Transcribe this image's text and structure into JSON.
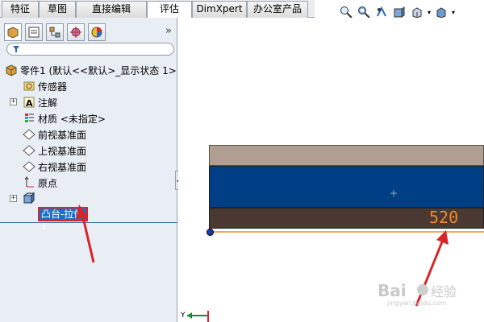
{
  "tabs": [
    {
      "label": "特征",
      "active": false
    },
    {
      "label": "草图",
      "active": false
    },
    {
      "label": "直接编辑",
      "active": false
    },
    {
      "label": "评估",
      "active": true
    },
    {
      "label": "DimXpert",
      "active": false
    },
    {
      "label": "办公室产品",
      "active": false
    }
  ],
  "toolbar": {
    "icons": [
      "zoom-to-fit-icon",
      "zoom-area-icon",
      "previous-view-icon",
      "section-view-icon",
      "view-orientation-icon",
      "display-style-icon"
    ]
  },
  "sidebar": {
    "tab_icons": [
      "feature-manager-icon",
      "property-manager-icon",
      "configuration-manager-icon",
      "dimxpert-manager-icon",
      "display-manager-icon"
    ],
    "collapse_label": "»",
    "tree": {
      "root_label": "零件1  (默认<<默认>_显示状态 1>",
      "items": [
        {
          "label": "传感器",
          "icon": "sensor-icon"
        },
        {
          "label": "注解",
          "icon": "annotation-icon"
        },
        {
          "label": "材质 <未指定>",
          "icon": "material-icon"
        },
        {
          "label": "前视基准面",
          "icon": "plane-icon"
        },
        {
          "label": "上视基准面",
          "icon": "plane-icon"
        },
        {
          "label": "右视基准面",
          "icon": "plane-icon"
        },
        {
          "label": "原点",
          "icon": "origin-icon"
        },
        {
          "label": "凸台-拉伸1",
          "icon": "extrude-icon",
          "selected": true
        }
      ]
    }
  },
  "viewport": {
    "dimension_value": "520",
    "colors": {
      "top_face": "#b19e93",
      "front_face": "#003f86",
      "bottom_face": "#4a3833",
      "dimension": "#f08a2a",
      "annotation_arrow": "#d7252a"
    },
    "axis_label": "Y"
  },
  "watermark": {
    "brand": "Bai",
    "brand2": "经验",
    "url": "jingyan.baidu.com"
  }
}
